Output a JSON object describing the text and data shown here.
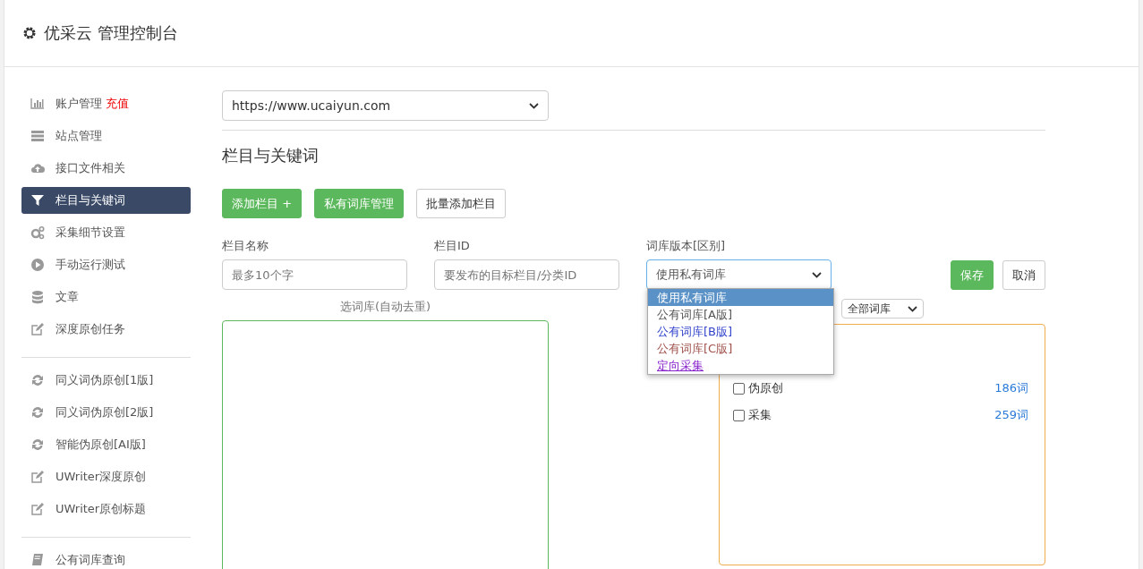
{
  "header": {
    "title": "优采云 管理控制台"
  },
  "sidebar": {
    "groups": [
      {
        "items": [
          {
            "label": "账户管理",
            "badge": "充值",
            "selected": false
          },
          {
            "label": "站点管理",
            "selected": false
          },
          {
            "label": "接口文件相关",
            "selected": false
          },
          {
            "label": "栏目与关键词",
            "selected": true
          },
          {
            "label": "采集细节设置",
            "selected": false
          },
          {
            "label": "手动运行测试",
            "selected": false
          },
          {
            "label": "文章",
            "selected": false
          },
          {
            "label": "深度原创任务",
            "selected": false
          }
        ]
      },
      {
        "items": [
          {
            "label": "同义词伪原创[1版]",
            "selected": false
          },
          {
            "label": "同义词伪原创[2版]",
            "selected": false
          },
          {
            "label": "智能伪原创[AI版]",
            "selected": false
          },
          {
            "label": "UWriter深度原创",
            "selected": false
          },
          {
            "label": "UWriter原创标题",
            "selected": false
          }
        ]
      },
      {
        "items": [
          {
            "label": "公有词库查询",
            "selected": false
          }
        ]
      }
    ]
  },
  "site_select": {
    "value": "https://www.ucaiyun.com"
  },
  "section_title": "栏目与关键词",
  "actions": [
    {
      "label": "添加栏目 +",
      "kind": "primary"
    },
    {
      "label": "私有词库管理",
      "kind": "primary"
    },
    {
      "label": "批量添加栏目",
      "kind": "default"
    }
  ],
  "form": {
    "fields": [
      {
        "label": "栏目名称",
        "placeholder": "最多10个字"
      },
      {
        "label": "栏目ID",
        "placeholder": "要发布的目标栏目/分类ID"
      }
    ],
    "library": {
      "label": "词库版本[区别]",
      "value": "使用私有词库",
      "open": true,
      "options": [
        {
          "label": "使用私有词库",
          "selected": true,
          "kind": "option"
        },
        {
          "label": "公有词库[A版]",
          "selected": false,
          "kind": "option"
        },
        {
          "label": "公有词库[B版]",
          "selected": false,
          "kind": "blue"
        },
        {
          "label": "公有词库[C版]",
          "selected": false,
          "kind": "brown"
        },
        {
          "label": "定向采集",
          "selected": false,
          "kind": "link"
        }
      ]
    },
    "save": "保存",
    "cancel": "取消"
  },
  "selected_title": "选词库(自动去重)",
  "filter": {
    "value": "全部词库"
  },
  "library_list": [
    {
      "label": "伪原创",
      "count": "186词",
      "checked": false
    },
    {
      "label": "采集",
      "count": "259词",
      "checked": false
    }
  ]
}
